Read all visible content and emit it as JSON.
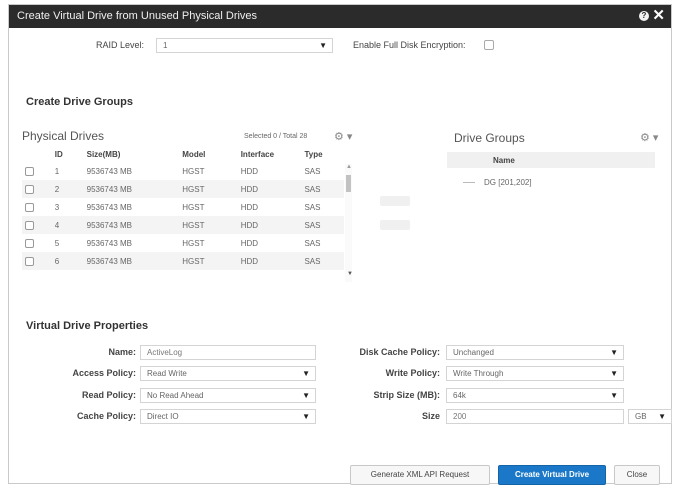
{
  "dialog": {
    "title": "Create Virtual Drive from Unused Physical Drives",
    "help_glyph": "?",
    "close_glyph": "✕"
  },
  "raid": {
    "label": "RAID Level:",
    "value": "1",
    "encryption_label": "Enable Full Disk Encryption:"
  },
  "create_groups_heading": "Create Drive Groups",
  "physical_drives": {
    "title": "Physical Drives",
    "selected_summary": "Selected 0 / Total 28",
    "columns": [
      "ID",
      "Size(MB)",
      "Model",
      "Interface",
      "Type"
    ],
    "rows": [
      {
        "id": "1",
        "size": "9536743 MB",
        "model": "HGST",
        "interface": "HDD",
        "type": "SAS"
      },
      {
        "id": "2",
        "size": "9536743 MB",
        "model": "HGST",
        "interface": "HDD",
        "type": "SAS"
      },
      {
        "id": "3",
        "size": "9536743 MB",
        "model": "HGST",
        "interface": "HDD",
        "type": "SAS"
      },
      {
        "id": "4",
        "size": "9536743 MB",
        "model": "HGST",
        "interface": "HDD",
        "type": "SAS"
      },
      {
        "id": "5",
        "size": "9536743 MB",
        "model": "HGST",
        "interface": "HDD",
        "type": "SAS"
      },
      {
        "id": "6",
        "size": "9536743 MB",
        "model": "HGST",
        "interface": "HDD",
        "type": "SAS"
      }
    ]
  },
  "drive_groups": {
    "title": "Drive Groups",
    "column": "Name",
    "items": [
      "DG [201,202]"
    ]
  },
  "vd_properties": {
    "heading": "Virtual Drive Properties",
    "name_label": "Name:",
    "name_value": "ActiveLog",
    "access_label": "Access Policy:",
    "access_value": "Read Write",
    "read_label": "Read Policy:",
    "read_value": "No Read Ahead",
    "cache_label": "Cache Policy:",
    "cache_value": "Direct IO",
    "disk_cache_label": "Disk Cache Policy:",
    "disk_cache_value": "Unchanged",
    "write_label": "Write Policy:",
    "write_value": "Write Through",
    "strip_label": "Strip Size (MB):",
    "strip_value": "64k",
    "size_label": "Size",
    "size_value": "200",
    "size_unit": "GB"
  },
  "buttons": {
    "xml": "Generate XML API Request",
    "create": "Create Virtual Drive",
    "close": "Close"
  },
  "glyphs": {
    "dropdown": "▼",
    "gear": "⚙ ▾",
    "scroll_up": "▲",
    "scroll_down": "▼"
  }
}
